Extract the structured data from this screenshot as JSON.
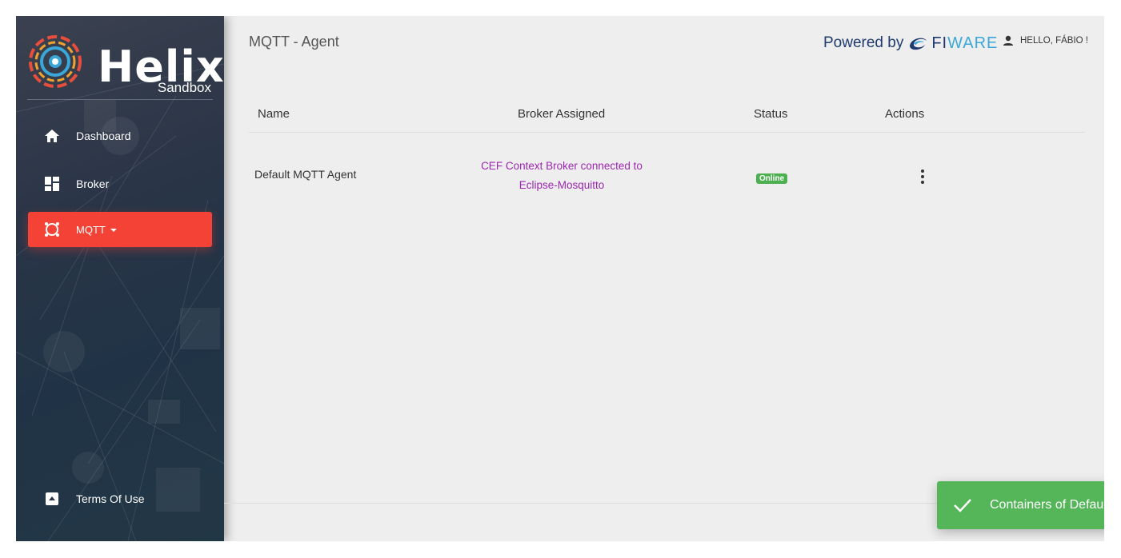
{
  "brand": {
    "name": "Helix",
    "subtitle": "Sandbox"
  },
  "sidebar": {
    "items": [
      {
        "label": "Dashboard",
        "icon": "home-icon"
      },
      {
        "label": "Broker",
        "icon": "dashboard-grid-icon"
      },
      {
        "label": "MQTT",
        "icon": "mqtt-icon",
        "active": true
      }
    ],
    "footer_item": {
      "label": "Terms Of Use",
      "icon": "terms-icon"
    }
  },
  "header": {
    "title": "MQTT - Agent",
    "powered_by": "Powered by",
    "fiware_prefix": "FI",
    "fiware_suffix": "WARE",
    "user_greeting": "HELLO, FÁBIO !"
  },
  "table": {
    "columns": [
      "Name",
      "Broker Assigned",
      "Status",
      "Actions"
    ],
    "rows": [
      {
        "name": "Default MQTT Agent",
        "broker_line1": "CEF Context Broker connected to",
        "broker_line2": "Eclipse-Mosquitto",
        "status": "Online"
      }
    ]
  },
  "footer": {
    "link_fragment": "!"
  },
  "toast": {
    "message": "Containers of Default MQTT Agent started",
    "close": "×"
  },
  "colors": {
    "accent_active": "#f44336",
    "link": "#9c27b0",
    "status_online": "#4caf50",
    "toast_bg": "#55b559"
  }
}
